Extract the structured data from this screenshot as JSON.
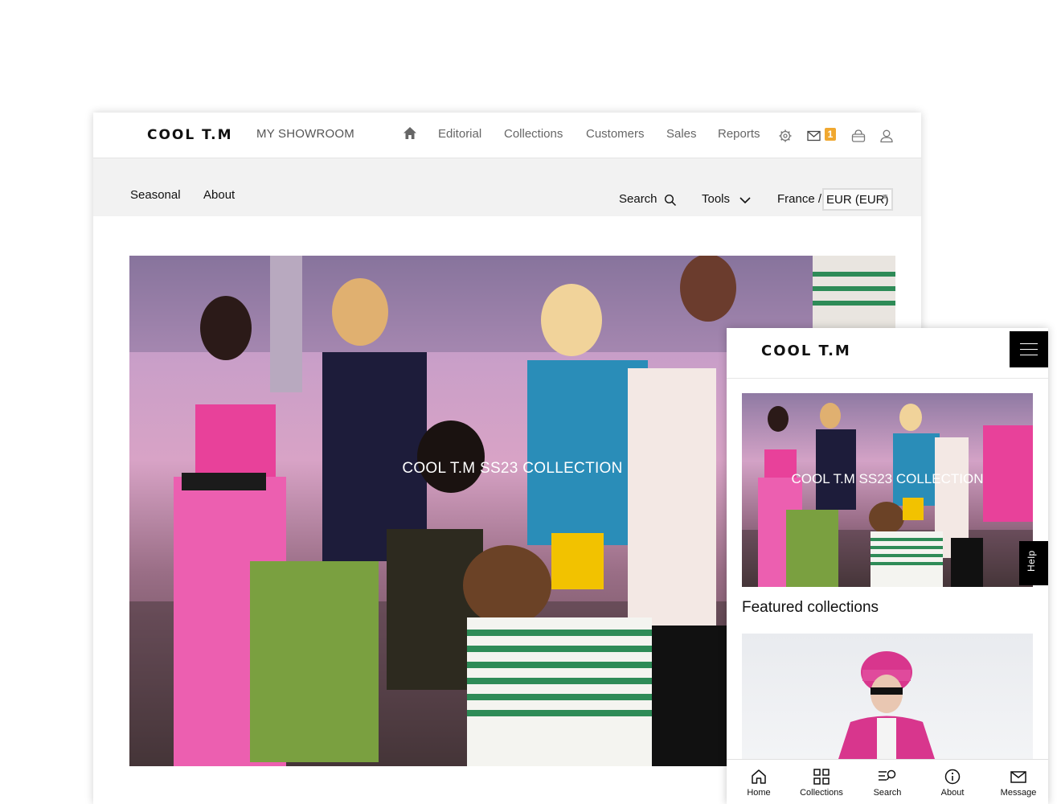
{
  "desktop": {
    "logo": "COOL T.M",
    "showroom": "MY SHOWROOM",
    "nav": {
      "editorial": "Editorial",
      "collections": "Collections",
      "customers": "Customers",
      "sales": "Sales",
      "reports": "Reports"
    },
    "icons": [
      "home-icon",
      "gear-icon",
      "mail-icon",
      "basket-icon",
      "user-icon"
    ],
    "mail_badge": "1",
    "subnav": {
      "seasonal": "Seasonal",
      "about": "About",
      "search": "Search",
      "tools": "Tools",
      "country": "France /",
      "currency": "EUR (EUR)"
    },
    "hero_title": "COOL T.M SS23 COLLECTION"
  },
  "mobile": {
    "logo": "COOL T.M",
    "hero_title": "COOL T.M SS23 COLLECTION",
    "help": "Help",
    "featured_title": "Featured collections",
    "bottom_nav": {
      "home": "Home",
      "collections": "Collections",
      "search": "Search",
      "about": "About",
      "message": "Message"
    }
  },
  "colors": {
    "badge": "#f0a830",
    "subbar_bg": "#f2f2f2",
    "accent_pink": "#e8419a"
  }
}
